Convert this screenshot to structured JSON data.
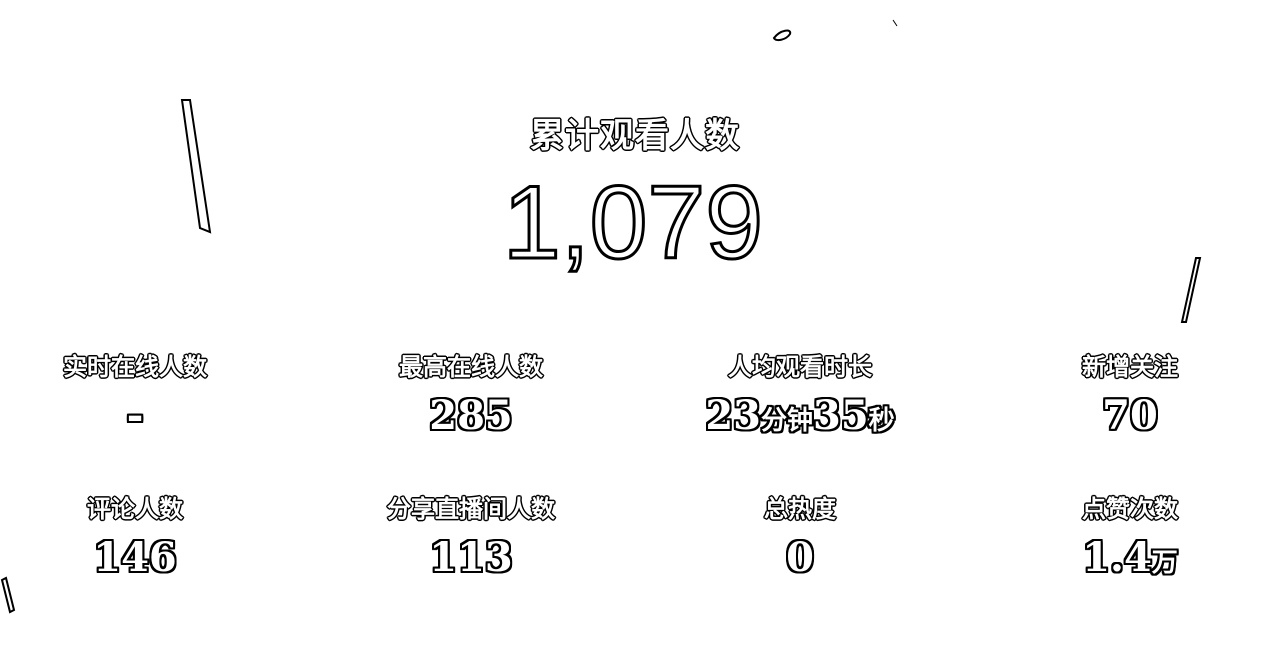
{
  "headline": {
    "label": "累计观看人数",
    "value": "1,079"
  },
  "stats": [
    {
      "label": "实时在线人数",
      "value": "-"
    },
    {
      "label": "最高在线人数",
      "value": "285"
    },
    {
      "label": "人均观看时长",
      "minutes": "23",
      "minutes_unit": "分钟",
      "seconds": "35",
      "seconds_unit": "秒"
    },
    {
      "label": "新增关注",
      "value": "70"
    },
    {
      "label": "评论人数",
      "value": "146"
    },
    {
      "label": "分享直播间人数",
      "value": "113"
    },
    {
      "label": "总热度",
      "value": "0"
    },
    {
      "label": "点赞次数",
      "value": "1.4",
      "unit": "万"
    }
  ],
  "colors": {
    "background": "#ffffff",
    "text_fill": "#ffffff",
    "text_outline": "#000000"
  }
}
